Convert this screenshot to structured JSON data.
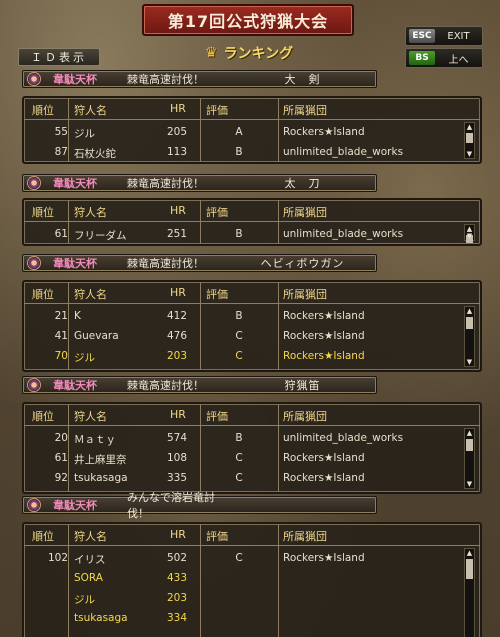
{
  "header": {
    "title": "第17回公式狩猟大会",
    "id_button": "ＩＤ表示",
    "ranking_title": "ランキング"
  },
  "keys": [
    {
      "key": "ESC",
      "label": "EXIT"
    },
    {
      "key": "BS",
      "label": "上へ"
    }
  ],
  "columns": {
    "rank": "順位",
    "name": "狩人名",
    "hr": "HR",
    "eval": "評価",
    "guild": "所属猟団"
  },
  "sections": [
    {
      "cup": "韋駄天杯",
      "task": "棘竜高速討伐！",
      "weapon": "大　剣",
      "rows": [
        {
          "rank": "55",
          "name": "ジル",
          "hr": "205",
          "eval": "A",
          "guild": "Rockers★Island",
          "highlight": false
        },
        {
          "rank": "87",
          "name": "石杖火鉈",
          "hr": "113",
          "eval": "B",
          "guild": "unlimited_blade_works",
          "highlight": false
        }
      ]
    },
    {
      "cup": "韋駄天杯",
      "task": "棘竜高速討伐！",
      "weapon": "太　刀",
      "rows": [
        {
          "rank": "61",
          "name": "フリーダム",
          "hr": "251",
          "eval": "B",
          "guild": "unlimited_blade_works",
          "highlight": false
        }
      ]
    },
    {
      "cup": "韋駄天杯",
      "task": "棘竜高速討伐！",
      "weapon": "ヘビィボウガン",
      "rows": [
        {
          "rank": "21",
          "name": "K",
          "hr": "412",
          "eval": "B",
          "guild": "Rockers★Island",
          "highlight": false
        },
        {
          "rank": "41",
          "name": "Guevara",
          "hr": "476",
          "eval": "C",
          "guild": "Rockers★Island",
          "highlight": false
        },
        {
          "rank": "70",
          "name": "ジル",
          "hr": "203",
          "eval": "C",
          "guild": "Rockers★Island",
          "highlight": true
        }
      ]
    },
    {
      "cup": "韋駄天杯",
      "task": "棘竜高速討伐！",
      "weapon": "狩猟笛",
      "rows": [
        {
          "rank": "20",
          "name": "Ｍａｔｙ",
          "hr": "574",
          "eval": "B",
          "guild": "unlimited_blade_works",
          "highlight": false
        },
        {
          "rank": "61",
          "name": "井上麻里奈",
          "hr": "108",
          "eval": "C",
          "guild": "Rockers★Island",
          "highlight": false
        },
        {
          "rank": "92",
          "name": "tsukasaga",
          "hr": "335",
          "eval": "C",
          "guild": "Rockers★Island",
          "highlight": false
        }
      ]
    },
    {
      "cup": "韋駄天杯",
      "task": "みんなで溶岩竜討伐！",
      "weapon": "",
      "rows": [
        {
          "rank": "102",
          "name": "イリス",
          "hr": "502",
          "eval": "C",
          "guild": "Rockers★Island",
          "highlight": false
        },
        {
          "rank": "",
          "name": "SORA",
          "hr": "433",
          "eval": "",
          "guild": "",
          "highlight": true
        },
        {
          "rank": "",
          "name": "ジル",
          "hr": "203",
          "eval": "",
          "guild": "",
          "highlight": true
        },
        {
          "rank": "",
          "name": "tsukasaga",
          "hr": "334",
          "eval": "",
          "guild": "",
          "highlight": true
        }
      ]
    }
  ]
}
